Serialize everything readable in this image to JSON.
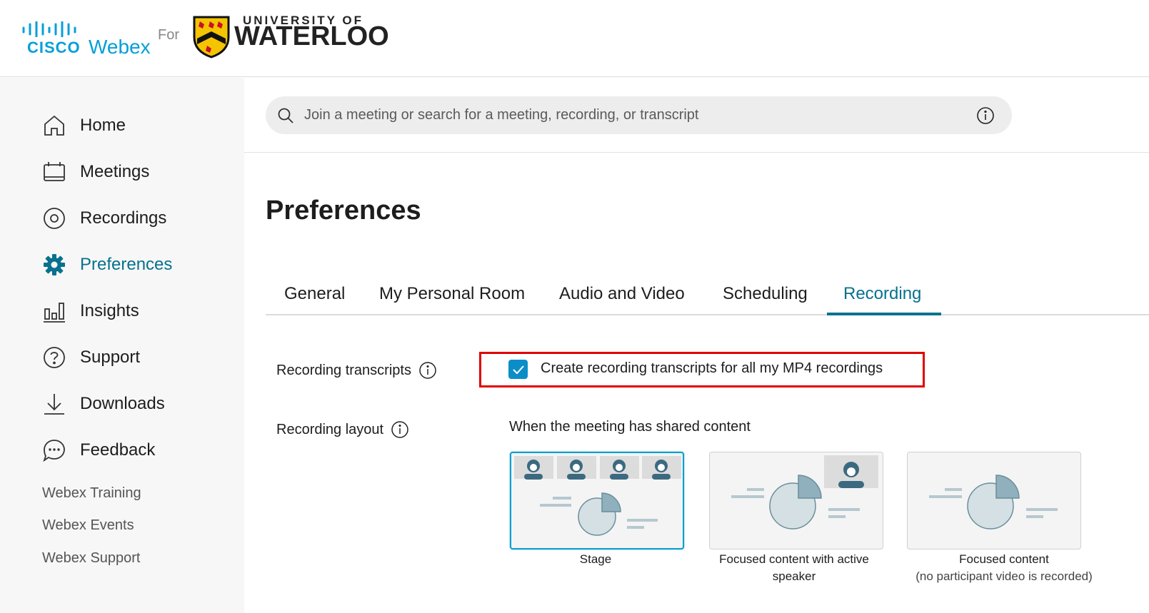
{
  "header": {
    "cisco_text": "CISCO",
    "webex_text": "Webex",
    "for_text": "For",
    "university_top": "UNIVERSITY OF",
    "university_main": "WATERLOO"
  },
  "sidebar": {
    "items": [
      {
        "label": "Home",
        "icon": "home-icon"
      },
      {
        "label": "Meetings",
        "icon": "calendar-icon"
      },
      {
        "label": "Recordings",
        "icon": "recordings-icon"
      },
      {
        "label": "Preferences",
        "icon": "gear-icon",
        "active": true
      },
      {
        "label": "Insights",
        "icon": "insights-icon"
      },
      {
        "label": "Support",
        "icon": "help-icon"
      },
      {
        "label": "Downloads",
        "icon": "download-icon"
      },
      {
        "label": "Feedback",
        "icon": "feedback-icon"
      }
    ],
    "links": [
      "Webex Training",
      "Webex Events",
      "Webex Support"
    ]
  },
  "search": {
    "placeholder": "Join a meeting or search for a meeting, recording, or transcript"
  },
  "page": {
    "title": "Preferences"
  },
  "tabs": [
    "General",
    "My Personal Room",
    "Audio and Video",
    "Scheduling",
    "Recording"
  ],
  "active_tab": "Recording",
  "recording": {
    "transcripts_label": "Recording transcripts",
    "transcripts_checkbox_label": "Create recording transcripts for all my MP4 recordings",
    "transcripts_checked": true,
    "layout_label": "Recording layout",
    "shared_content_text": "When the meeting has shared content",
    "layouts": [
      {
        "caption": "Stage",
        "selected": true
      },
      {
        "caption": "Focused content with active speaker",
        "selected": false
      },
      {
        "caption_line1": "Focused content",
        "caption_line2": "(no participant video is recorded)",
        "selected": false
      }
    ]
  },
  "colors": {
    "accent": "#07718e",
    "checkbox": "#0b8ec7",
    "highlight": "#e00000",
    "cisco_blue": "#049fd9"
  }
}
